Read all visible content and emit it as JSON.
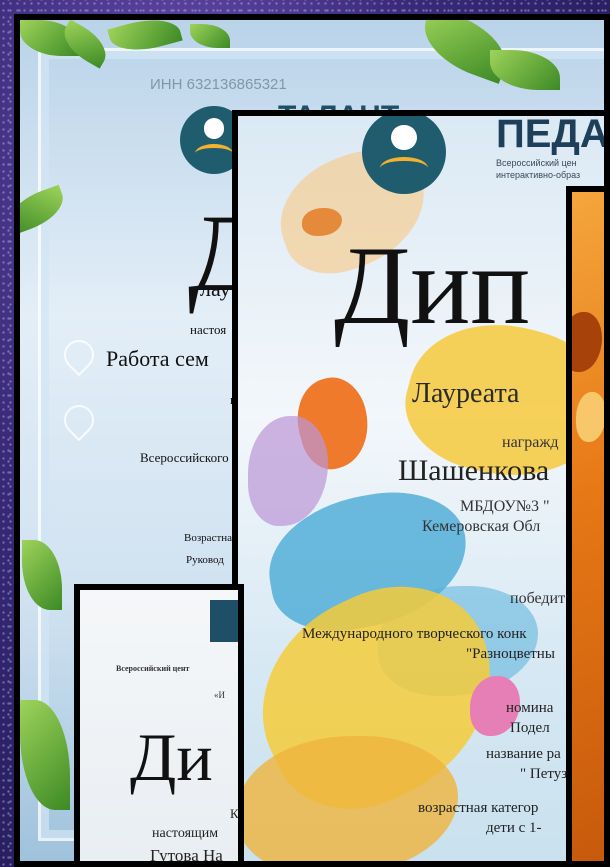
{
  "card1": {
    "inn": "ИНН 632136865321",
    "brand": "ТАЛАНТ",
    "title": "Д",
    "subtitle": "лау",
    "line1": "настоя",
    "line2": "Работа сем",
    "line3": "к",
    "line4": "Всероссийского",
    "line5": "Возрастна",
    "line6": "Руковод"
  },
  "card2": {
    "brand": "ПЕДА",
    "brand_sub1": "Всероссийский цен",
    "brand_sub2": "интерактивно-образ",
    "title": "Дип",
    "laureate": "Лауреата",
    "awarded": "награжд",
    "name": "Шашенкова",
    "org": "МБДОУ№3 \"",
    "region": "Кемеровская Обл",
    "winner": "победит",
    "contest": "Международного творческого конк",
    "contest_name": "\"Разноцветны",
    "nomination": "номина",
    "nomination_value": "Подел",
    "work_title": "название ра",
    "work_value": "\" Петуз",
    "age_category": "возрастная категор",
    "age_value": "дети с 1-"
  },
  "card4": {
    "center": "Всероссийский цент",
    "quote": "«И",
    "title": "Ди",
    "line1": "К",
    "line2": "настоящим",
    "name": "Гутова На"
  }
}
